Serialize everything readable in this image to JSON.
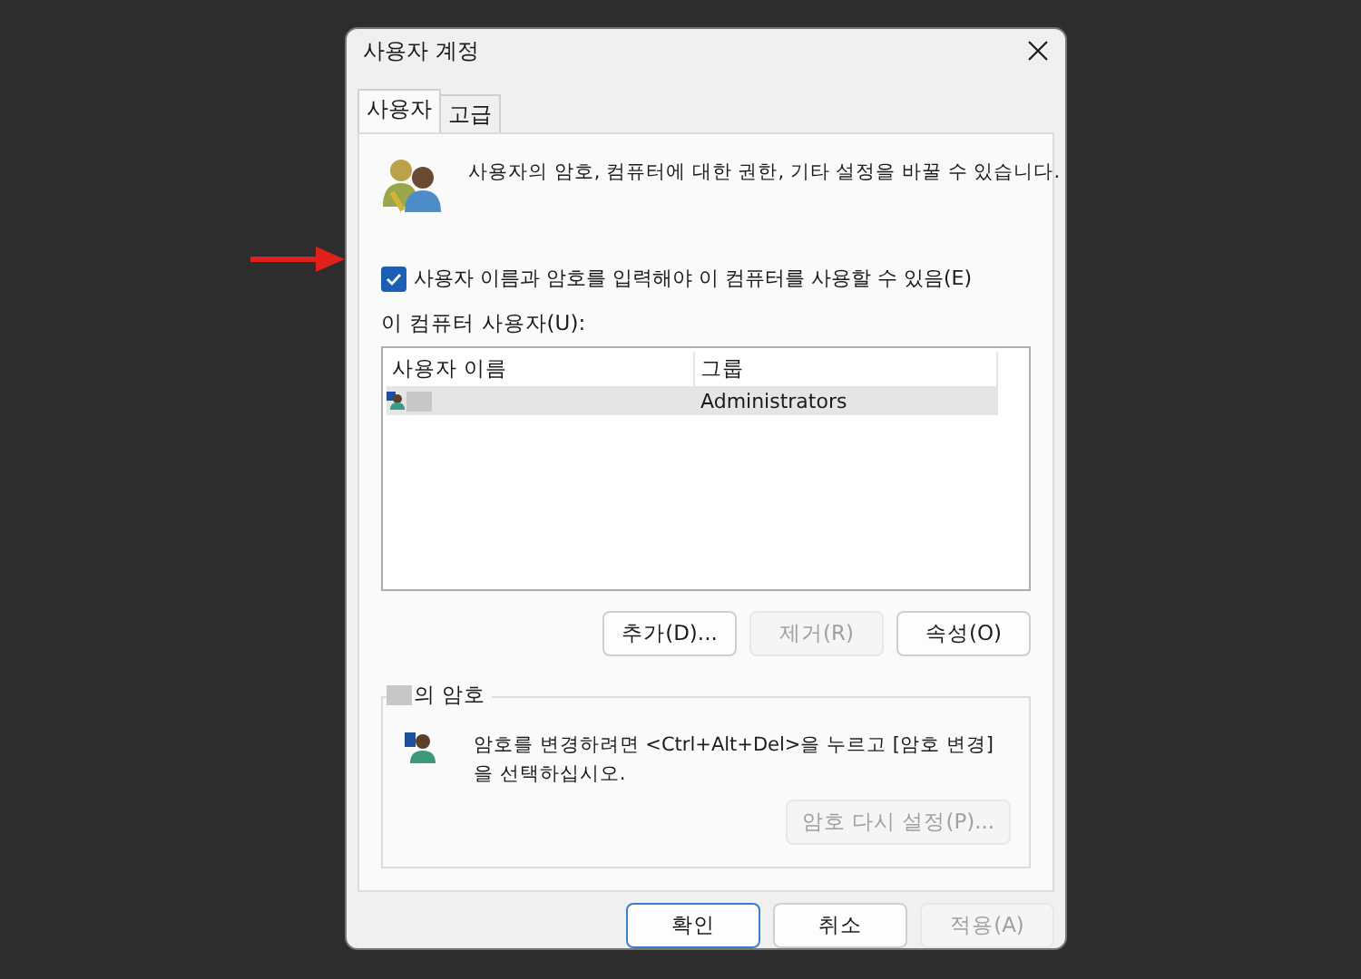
{
  "window": {
    "title": "사용자 계정"
  },
  "tabs": [
    {
      "label": "사용자",
      "selected": true
    },
    {
      "label": "고급",
      "selected": false
    }
  ],
  "description": "사용자의 암호, 컴퓨터에 대한 권한, 기타 설정을 바꿀 수 있습니다.",
  "require_login": {
    "label": "사용자 이름과 암호를 입력해야 이 컴퓨터를 사용할 수 있음(E)",
    "checked": true
  },
  "users": {
    "label": "이 컴퓨터 사용자(U):",
    "columns": [
      "사용자 이름",
      "그룹"
    ],
    "rows": [
      {
        "group": "Administrators",
        "selected": true
      }
    ]
  },
  "user_buttons": [
    {
      "label": "추가(D)...",
      "disabled": false
    },
    {
      "label": "제거(R)",
      "disabled": true
    },
    {
      "label": "속성(O)",
      "disabled": false
    }
  ],
  "password_group": {
    "title": "의 암호",
    "text": "암호를 변경하려면 <Ctrl+Alt+Del>을 누르고 [암호 변경]을 선택하십시오.",
    "reset_button": {
      "label": "암호 다시 설정(P)...",
      "disabled": true
    }
  },
  "footer_buttons": [
    {
      "label": "확인",
      "default": true,
      "disabled": false
    },
    {
      "label": "취소",
      "default": false,
      "disabled": false
    },
    {
      "label": "적용(A)",
      "default": false,
      "disabled": true
    }
  ]
}
